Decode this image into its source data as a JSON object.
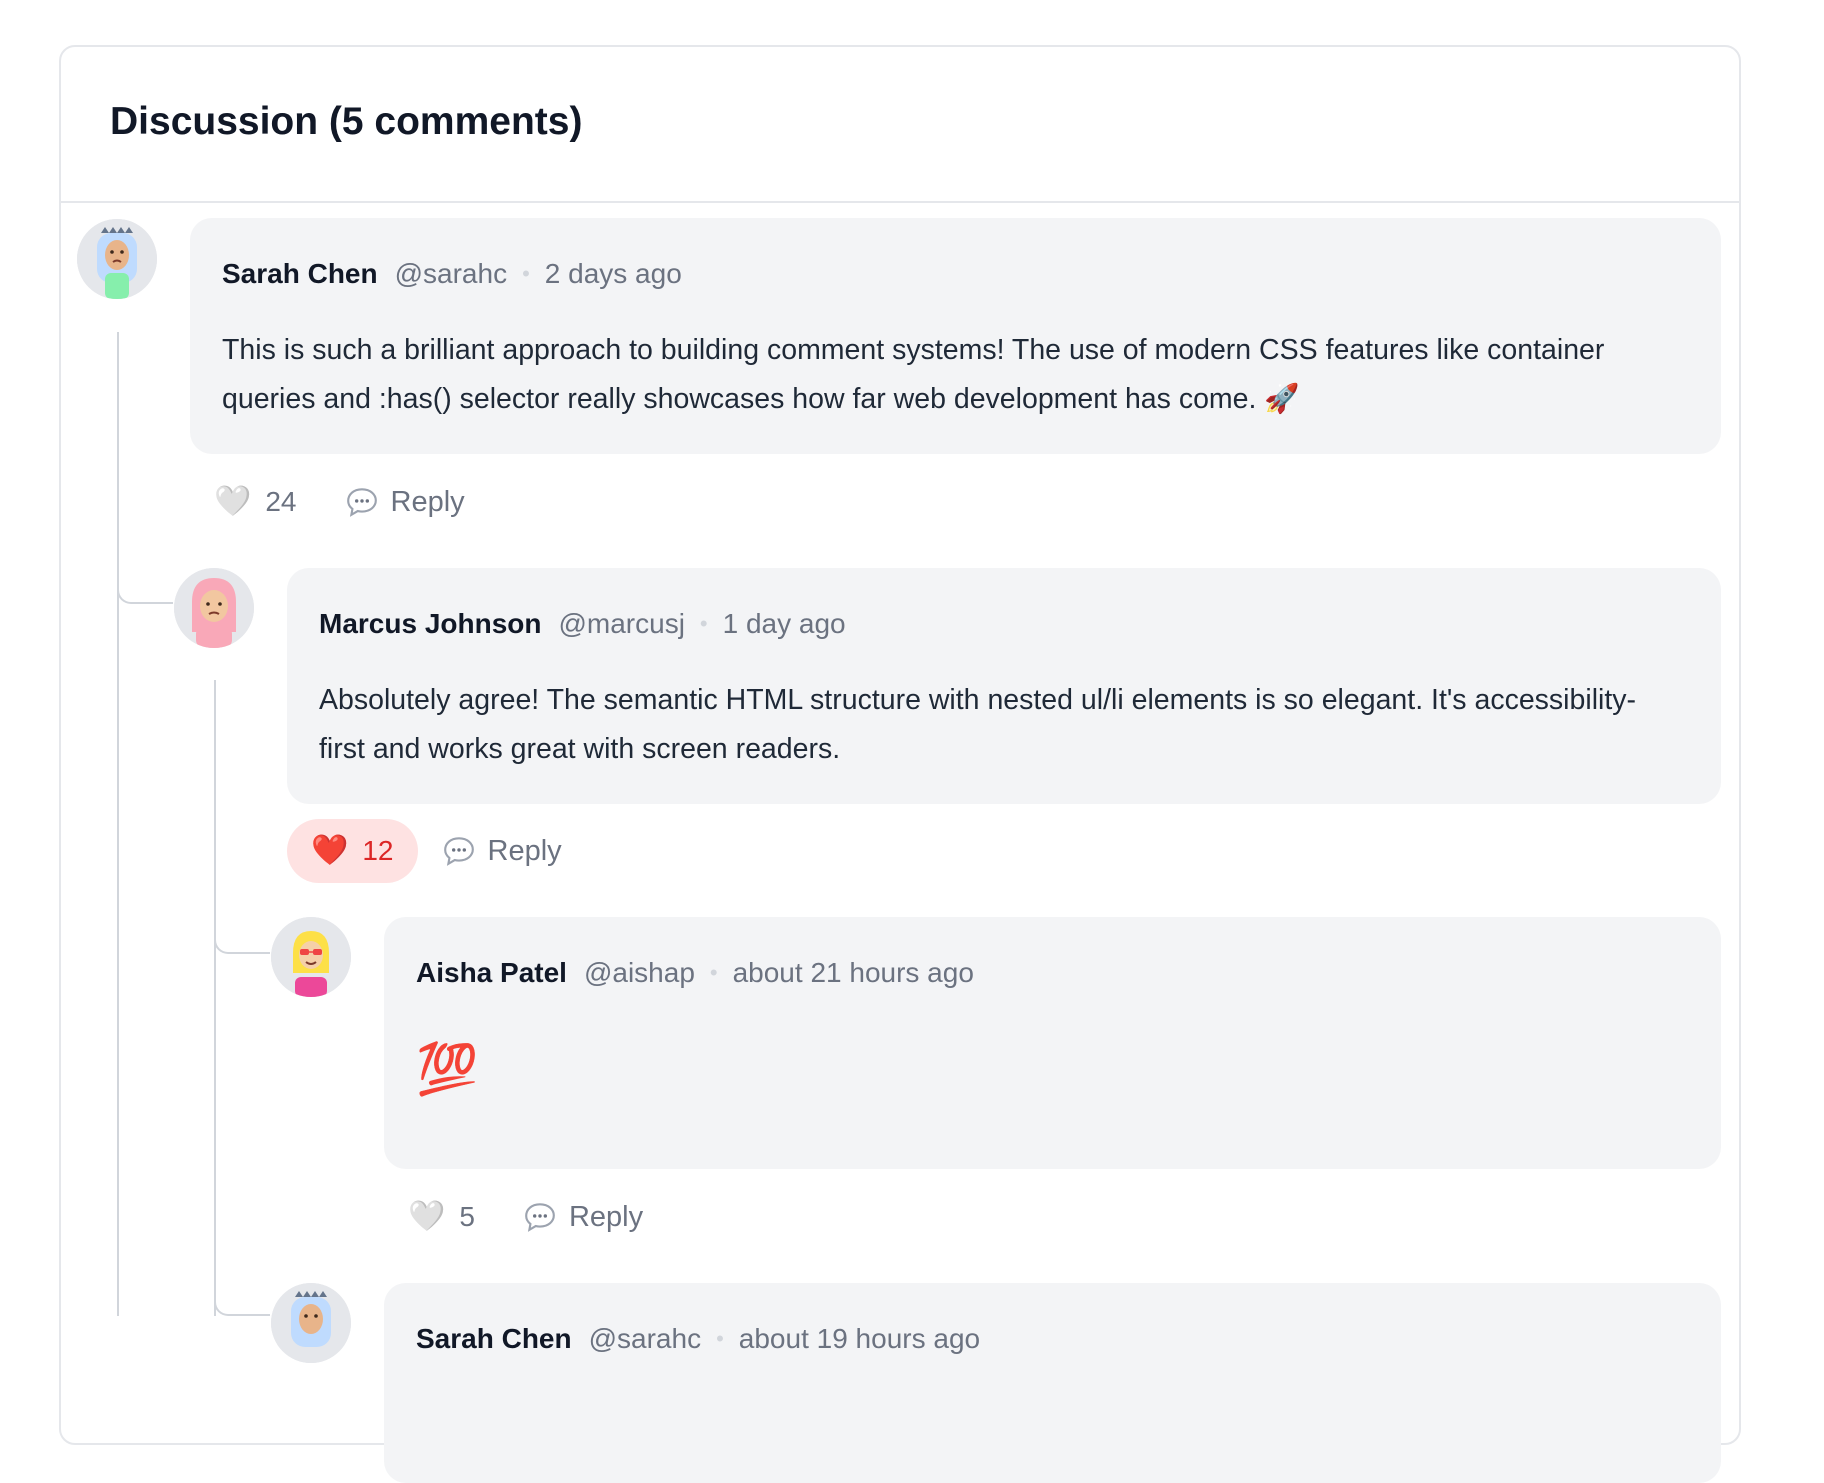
{
  "header": {
    "title": "Discussion (5 comments)"
  },
  "comments": [
    {
      "author": "Sarah Chen",
      "handle": "@sarahc",
      "time": "2 days ago",
      "body": "This is such a brilliant approach to building comment systems! The use of modern CSS features like container queries and :has() selector really showcases how far web development has come. 🚀",
      "likes": "24",
      "liked": false,
      "reply_label": "Reply"
    },
    {
      "author": "Marcus Johnson",
      "handle": "@marcusj",
      "time": "1 day ago",
      "body": "Absolutely agree! The semantic HTML structure with nested ul/li elements is so elegant. It's accessibility-first and works great with screen readers.",
      "likes": "12",
      "liked": true,
      "reply_label": "Reply"
    },
    {
      "author": "Aisha Patel",
      "handle": "@aishap",
      "time": "about 21 hours ago",
      "body": "💯",
      "likes": "5",
      "liked": false,
      "reply_label": "Reply"
    },
    {
      "author": "Sarah Chen",
      "handle": "@sarahc",
      "time": "about 19 hours ago"
    }
  ],
  "icons": {
    "heart_empty": "🤍",
    "heart_filled": "❤️",
    "separator": "•",
    "reply": "speech-bubble-icon"
  },
  "colors": {
    "like_active_bg": "#fee2e2",
    "like_active_text": "#dc2626",
    "bubble_bg": "#f3f4f6",
    "muted_text": "#6b7280"
  }
}
